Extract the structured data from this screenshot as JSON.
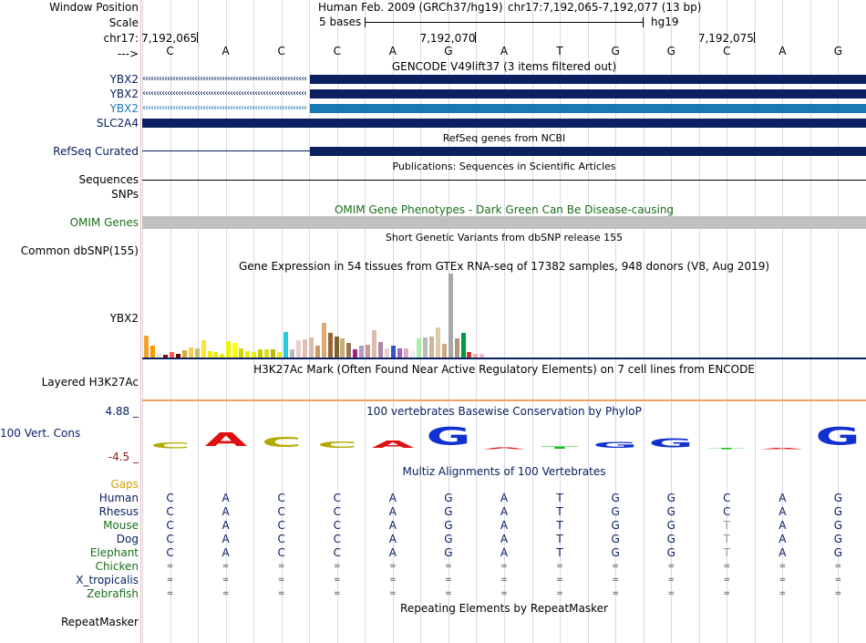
{
  "header": {
    "window_position_label": "Window Position",
    "scale_label": "Scale",
    "chrom_label": "chr17:",
    "arrow_label": "--->",
    "assembly_title": "Human Feb. 2009 (GRCh37/hg19)",
    "position_text": "chr17:7,192,065-7,192,077 (13 bp)",
    "scale_text": "5 bases",
    "scale_db": "hg19",
    "coord_ticks": [
      "7,192,065",
      "7,192,070",
      "7,192,075"
    ]
  },
  "sequence": [
    "C",
    "A",
    "C",
    "C",
    "A",
    "G",
    "A",
    "T",
    "G",
    "G",
    "C",
    "A",
    "G"
  ],
  "colors": {
    "navy": "#0a2060",
    "ybx2_highlight": "#1878b4",
    "omim_gray": "#c0c0c0",
    "phylop_max": "#0a2060",
    "phylop_min": "#8b1a1a",
    "gaps": "#d4a000",
    "green_species": "#1a6e1a"
  },
  "tracks": {
    "gencode": {
      "title": "GENCODE V49lift37 (3 items filtered out)",
      "items": [
        "YBX2",
        "YBX2",
        "YBX2",
        "SLC2A4"
      ]
    },
    "refseq": {
      "title": "RefSeq genes from NCBI",
      "label": "RefSeq Curated"
    },
    "publications": {
      "title": "Publications: Sequences in Scientific Articles",
      "labels": [
        "Sequences",
        "SNPs"
      ]
    },
    "omim": {
      "title": "OMIM Gene Phenotypes - Dark Green Can Be Disease-causing",
      "label": "OMIM Genes"
    },
    "dbsnp": {
      "title": "Short Genetic Variants from dbSNP release 155",
      "label": "Common dbSNP(155)"
    },
    "gtex": {
      "title": "Gene Expression in 54 tissues from GTEx RNA-seq of 17382 samples, 948 donors (V8, Aug 2019)",
      "label": "YBX2"
    },
    "h3k27ac": {
      "title": "H3K27Ac Mark (Often Found Near Active Regulatory Elements) on 7 cell lines from ENCODE",
      "label": "Layered H3K27Ac"
    },
    "phylop": {
      "title": "100 vertebrates Basewise Conservation by PhyloP",
      "label": "100 Vert. Cons",
      "max": "4.88 _",
      "min": "-4.5 _"
    },
    "multiz": {
      "title": "Multiz Alignments of 100 Vertebrates",
      "gaps_label": "Gaps"
    },
    "repeatmasker": {
      "title": "Repeating Elements by RepeatMasker",
      "label": "RepeatMasker"
    }
  },
  "species": [
    {
      "name": "Human",
      "row": "CACCAGATGGCAG"
    },
    {
      "name": "Rhesus",
      "row": "CACCAGATGGCAG"
    },
    {
      "name": "Mouse",
      "row": "CACCAGATGGTAG"
    },
    {
      "name": "Dog",
      "row": "CACCAGATGGTAG"
    },
    {
      "name": "Elephant",
      "row": "CACCAGATGGTAG"
    },
    {
      "name": "Chicken",
      "row": "============="
    },
    {
      "name": "X_tropicalis",
      "row": "============="
    },
    {
      "name": "Zebrafish",
      "row": "============="
    }
  ],
  "phylop_logo": [
    {
      "base": "C",
      "score": 0.18
    },
    {
      "base": "A",
      "score": 0.43
    },
    {
      "base": "C",
      "score": 0.32
    },
    {
      "base": "C",
      "score": 0.2
    },
    {
      "base": "A",
      "score": 0.22
    },
    {
      "base": "G",
      "score": 0.55
    },
    {
      "base": "A",
      "score": 0.06
    },
    {
      "base": "T",
      "score": 0.08
    },
    {
      "base": "G",
      "score": 0.19
    },
    {
      "base": "G",
      "score": 0.28
    },
    {
      "base": "T",
      "score": 0.02
    },
    {
      "base": "A",
      "score": 0.02
    },
    {
      "base": "G",
      "score": 0.55
    }
  ],
  "gtex_bars": [
    {
      "h": 24,
      "c": "#f2a22a"
    },
    {
      "h": 13,
      "c": "#ff9900"
    },
    {
      "h": 4,
      "c": "#e6e6e6"
    },
    {
      "h": 3,
      "c": "#8b0000"
    },
    {
      "h": 6,
      "c": "#ff5555"
    },
    {
      "h": 4,
      "c": "#6a0000"
    },
    {
      "h": 8,
      "c": "#ddaa33"
    },
    {
      "h": 11,
      "c": "#ffcc55"
    },
    {
      "h": 10,
      "c": "#ccc266"
    },
    {
      "h": 19,
      "c": "#ffe033"
    },
    {
      "h": 7,
      "c": "#eeee00"
    },
    {
      "h": 6,
      "c": "#eeee00"
    },
    {
      "h": 4,
      "c": "#eeee00"
    },
    {
      "h": 18,
      "c": "#f2f200"
    },
    {
      "h": 16,
      "c": "#ffff00"
    },
    {
      "h": 10,
      "c": "#d4d400"
    },
    {
      "h": 7,
      "c": "#eeee00"
    },
    {
      "h": 6,
      "c": "#eeee00"
    },
    {
      "h": 9,
      "c": "#cccc00"
    },
    {
      "h": 9,
      "c": "#dddd33"
    },
    {
      "h": 9,
      "c": "#bbbb00"
    },
    {
      "h": 6,
      "c": "#eeee22"
    },
    {
      "h": 28,
      "c": "#22ccdd"
    },
    {
      "h": 9,
      "c": "#bbbbbb"
    },
    {
      "h": 19,
      "c": "#eecccc"
    },
    {
      "h": 20,
      "c": "#dfbfb3"
    },
    {
      "h": 22,
      "c": "#ddbbaa"
    },
    {
      "h": 13,
      "c": "#cc9966"
    },
    {
      "h": 38,
      "c": "#ddaa77"
    },
    {
      "h": 27,
      "c": "#996633"
    },
    {
      "h": 23,
      "c": "#776633"
    },
    {
      "h": 21,
      "c": "#ccaa77"
    },
    {
      "h": 16,
      "c": "#997755"
    },
    {
      "h": 9,
      "c": "#aa2288"
    },
    {
      "h": 13,
      "c": "#b299cc"
    },
    {
      "h": 14,
      "c": "#cc9999"
    },
    {
      "h": 30,
      "c": "#ddbbaa"
    },
    {
      "h": 17,
      "c": "#aa88aa"
    },
    {
      "h": 10,
      "c": "#eecccc"
    },
    {
      "h": 13,
      "c": "#3355cc"
    },
    {
      "h": 10,
      "c": "#9966cc"
    },
    {
      "h": 10,
      "c": "#ddaacc"
    },
    {
      "h": 7,
      "c": "#eeeeee"
    },
    {
      "h": 21,
      "c": "#aaeeaa"
    },
    {
      "h": 22,
      "c": "#bbbbbb"
    },
    {
      "h": 23,
      "c": "#cfb699"
    },
    {
      "h": 33,
      "c": "#ddccaa"
    },
    {
      "h": 15,
      "c": "#ccaa88"
    },
    {
      "h": 92,
      "c": "#a8a8a8"
    },
    {
      "h": 21,
      "c": "#aa9977"
    },
    {
      "h": 27,
      "c": "#009944"
    },
    {
      "h": 6,
      "c": "#cc3333"
    },
    {
      "h": 4,
      "c": "#ffaaaa"
    },
    {
      "h": 4,
      "c": "#eebbdd"
    }
  ]
}
